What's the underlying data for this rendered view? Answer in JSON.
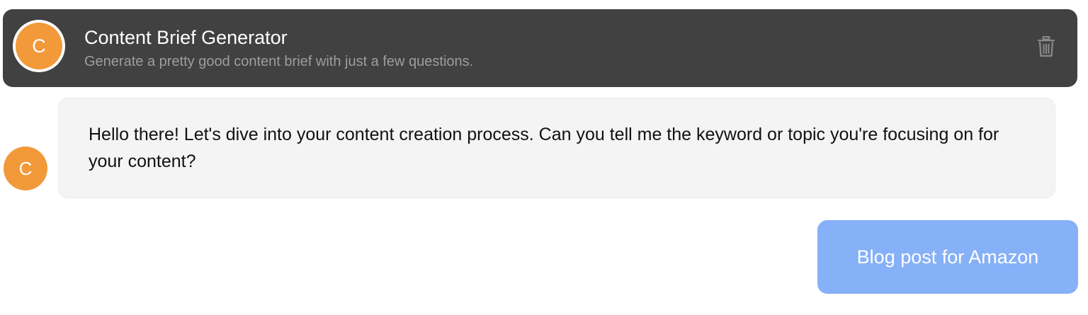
{
  "header": {
    "avatar_letter": "C",
    "title": "Content Brief Generator",
    "subtitle": "Generate a pretty good content brief with just a few questions.",
    "delete_icon": "trash-icon"
  },
  "messages": [
    {
      "role": "assistant",
      "avatar_letter": "C",
      "text": "Hello there! Let's dive into your content creation process. Can you tell me the keyword or topic you're focusing on for your content?"
    },
    {
      "role": "user",
      "text": "Blog post for Amazon"
    }
  ],
  "colors": {
    "header_bg": "#414141",
    "avatar": "#f2993a",
    "assistant_bubble": "#f4f4f4",
    "user_bubble": "#86b0f7"
  }
}
